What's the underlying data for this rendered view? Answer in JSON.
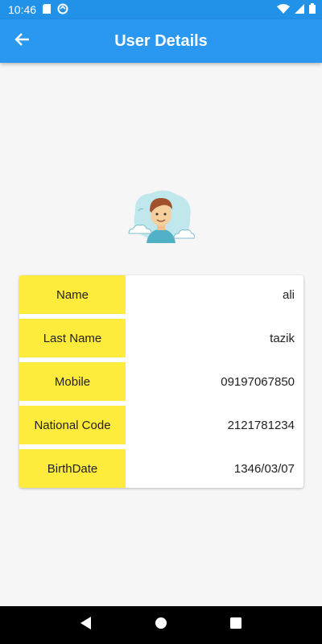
{
  "status_bar": {
    "time": "10:46",
    "icons": [
      "sd-card-icon",
      "sync-icon",
      "wifi-icon",
      "signal-icon",
      "battery-icon"
    ],
    "color": "#2291e8"
  },
  "app_bar": {
    "title": "User Details",
    "back_icon": "arrow-back-icon",
    "color": "#2a98f0"
  },
  "details": {
    "label_color": "#ffeb3b",
    "rows": [
      {
        "label": "Name",
        "value": "ali"
      },
      {
        "label": "Last Name",
        "value": "tazik"
      },
      {
        "label": "Mobile",
        "value": "09197067850"
      },
      {
        "label": "National Code",
        "value": "2121781234"
      },
      {
        "label": "BirthDate",
        "value": "1346/03/07"
      }
    ]
  },
  "nav_bar": {
    "icons": [
      "back-triangle-icon",
      "home-circle-icon",
      "recents-square-icon"
    ]
  }
}
